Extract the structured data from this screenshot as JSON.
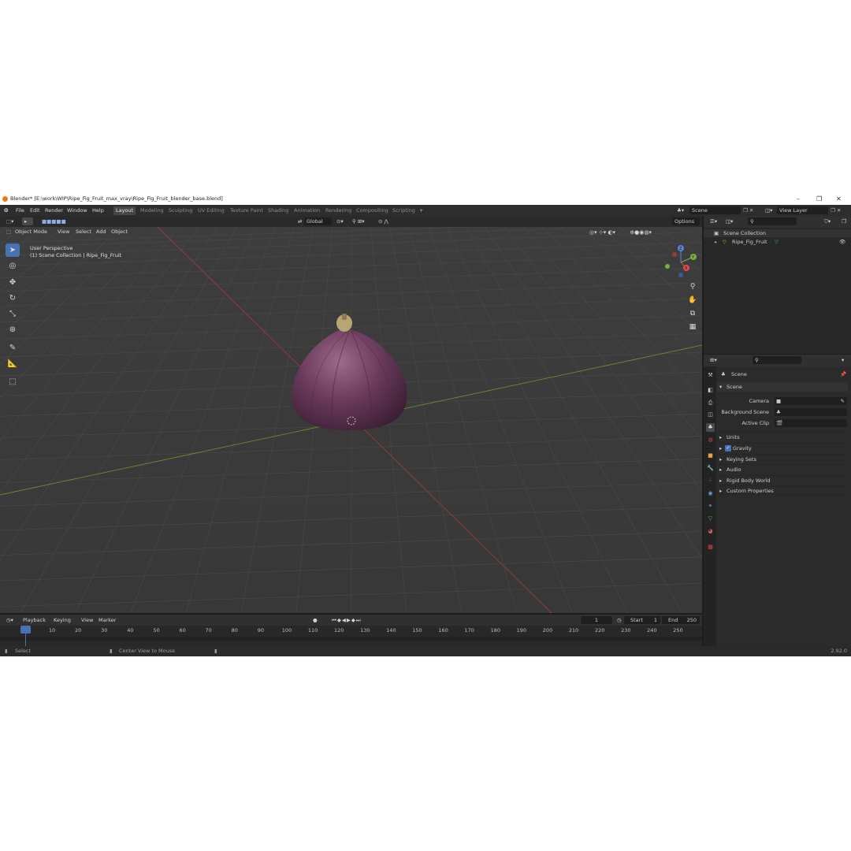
{
  "window": {
    "title": "Blender* [E:\\work\\WIP\\Ripe_Fig_Fruit_max_vray\\Ripe_Fig_Fruit_blender_base.blend]",
    "minimize": "–",
    "maximize": "❐",
    "close": "✕"
  },
  "menu": [
    "File",
    "Edit",
    "Render",
    "Window",
    "Help"
  ],
  "workspaces": [
    "Layout",
    "Modeling",
    "Sculpting",
    "UV Editing",
    "Texture Paint",
    "Shading",
    "Animation",
    "Rendering",
    "Compositing",
    "Scripting"
  ],
  "add_workspace": "+",
  "scene_field": "Scene",
  "view_layer_field": "View Layer",
  "viewport_header": {
    "mode": "Object Mode",
    "menus": [
      "View",
      "Select",
      "Add",
      "Object"
    ],
    "orientation": "Global",
    "options": "Options"
  },
  "viewport": {
    "perspective": "User Perspective",
    "collection": "(1) Scene Collection | Ripe_Fig_Fruit",
    "gizmo": {
      "x": "X",
      "y": "Y",
      "z": "Z"
    }
  },
  "outliner": {
    "root": "Scene Collection",
    "items": [
      "Ripe_Fig_Fruit"
    ]
  },
  "properties": {
    "breadcrumb": "Scene",
    "panel": "Scene",
    "fields": [
      {
        "label": "Camera"
      },
      {
        "label": "Background Scene"
      },
      {
        "label": "Active Clip"
      }
    ],
    "sections": [
      "Units",
      "Gravity",
      "Keying Sets",
      "Audio",
      "Rigid Body World",
      "Custom Properties"
    ]
  },
  "timeline": {
    "menus": [
      "Playback",
      "Keying",
      "View",
      "Marker"
    ],
    "current_frame": "1",
    "start_label": "Start",
    "start": "1",
    "end_label": "End",
    "end": "250",
    "ticks": [
      "1",
      "10",
      "20",
      "30",
      "40",
      "50",
      "60",
      "70",
      "80",
      "90",
      "100",
      "110",
      "120",
      "130",
      "140",
      "150",
      "160",
      "170",
      "180",
      "190",
      "200",
      "210",
      "220",
      "230",
      "240",
      "250"
    ]
  },
  "status": {
    "select": "Select",
    "center": "Center View to Mouse",
    "version": "2.92.0"
  },
  "colors": {
    "accent": "#4772b3",
    "fig": "#6b3a5c",
    "x_axis": "#9a3b3b",
    "y_axis": "#6d8c2c"
  }
}
